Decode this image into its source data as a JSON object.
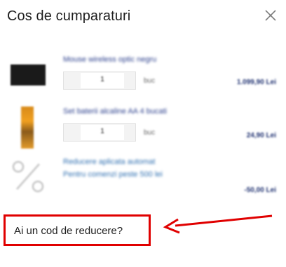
{
  "header": {
    "title": "Cos de cumparaturi"
  },
  "items": [
    {
      "name": "Mouse wireless optic negru",
      "quantity": "1",
      "unit": "buc",
      "price": "1.099,90 Lei"
    },
    {
      "name": "Set baterii alcaline AA 4 bucati",
      "quantity": "1",
      "unit": "buc",
      "price": "24,90 Lei"
    }
  ],
  "discount": {
    "line1": "Reducere aplicata automat",
    "line2": "Pentru comenzi peste 500 lei",
    "amount": "-50,00 Lei"
  },
  "coupon": {
    "label": "Ai un cod de reducere?"
  },
  "colors": {
    "annotation": "#e00000",
    "link_blue": "#2f6fb0"
  }
}
